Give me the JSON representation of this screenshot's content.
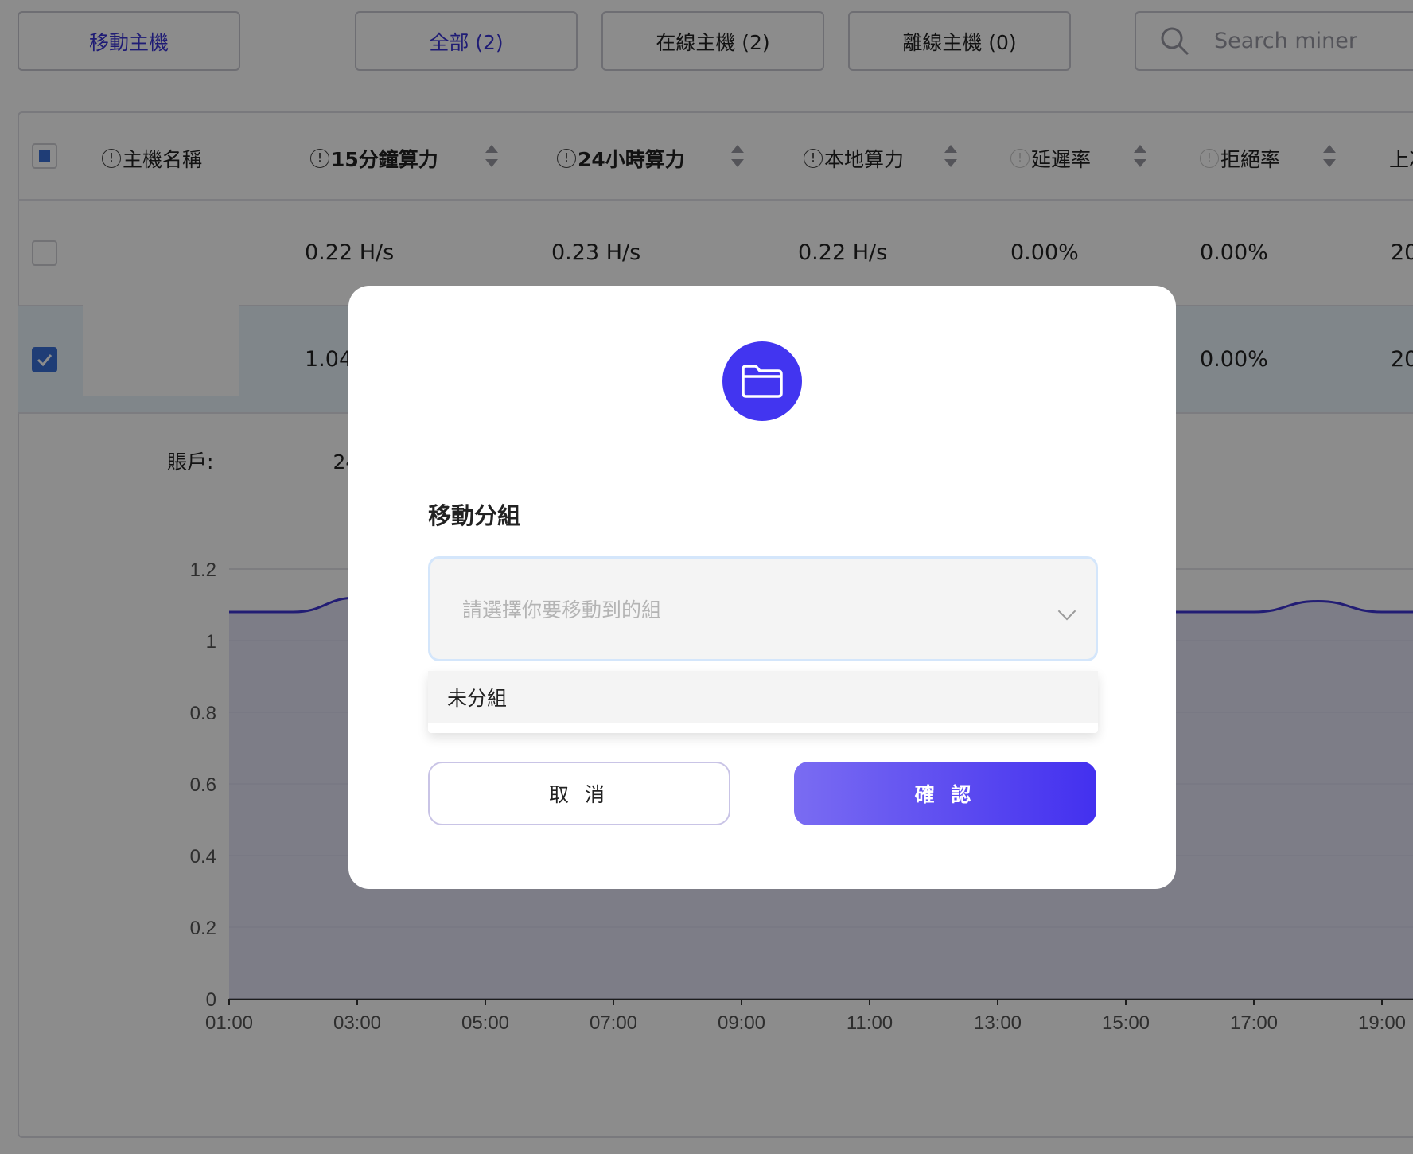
{
  "toolbar": {
    "move_host": "移動主機",
    "filter_all": "全部 (2)",
    "filter_online": "在線主機 (2)",
    "filter_offline": "離線主機 (0)",
    "search_placeholder": "Search miner"
  },
  "table": {
    "headers": {
      "host_name": "主機名稱",
      "hash_15m": "15分鐘算力",
      "hash_24h": "24小時算力",
      "local_hash": "本地算力",
      "latency": "延遲率",
      "reject": "拒絕率",
      "last": "上次"
    },
    "rows": [
      {
        "checked": false,
        "hash_15m": "0.22 H/s",
        "hash_24h": "0.23 H/s",
        "local_hash": "0.22 H/s",
        "latency": "0.00%",
        "reject": "0.00%",
        "last": "20"
      },
      {
        "checked": true,
        "hash_15m": "1.04",
        "reject": "0.00%",
        "last": "20"
      }
    ]
  },
  "account": {
    "label": "賬戶:",
    "suffix": "24"
  },
  "chart_data": {
    "type": "area",
    "title": "",
    "xlabel": "",
    "ylabel": "",
    "x": [
      "01:00",
      "02:00",
      "03:00",
      "09:00",
      "15:00",
      "16:00",
      "17:00",
      "18:00",
      "19:00"
    ],
    "y": [
      1.08,
      1.08,
      1.12,
      1.08,
      1.08,
      1.08,
      1.08,
      1.11,
      1.08
    ],
    "x_ticks": [
      "01:00",
      "03:00",
      "05:00",
      "07:00",
      "09:00",
      "11:00",
      "13:00",
      "15:00",
      "17:00",
      "19:00"
    ],
    "y_ticks": [
      "0",
      "0.2",
      "0.4",
      "0.6",
      "0.8",
      "1",
      "1.2"
    ],
    "ylim": [
      0,
      1.2
    ],
    "grid": true,
    "line_color": "#3f35d4"
  },
  "modal": {
    "icon": "folder-icon",
    "title": "移動分組",
    "select_placeholder": "請選擇你要移動到的組",
    "options": [
      "未分組"
    ],
    "cancel": "取 消",
    "confirm": "確 認"
  },
  "colors": {
    "accent": "#4235f0",
    "accent_light": "#7a6cf2",
    "overlay": "rgba(0,0,0,0.45)"
  }
}
